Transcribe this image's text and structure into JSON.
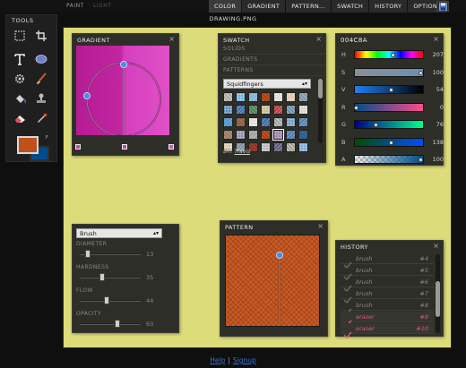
{
  "topbar": {
    "modes": [
      "PAINT",
      "LIGHT"
    ],
    "tabs": [
      "COLOR",
      "GRADIENT",
      "PATTERN...",
      "SWATCH",
      "HISTORY",
      "OPTIONS"
    ]
  },
  "document": {
    "title": "DRAWING.PNG"
  },
  "toolbox": {
    "title": "TOOLS",
    "fg_color": "#c0511b",
    "bg_color": "#004c8a",
    "swap_label": "F"
  },
  "canvas": {
    "background": "#dcdc7a"
  },
  "gradient_panel": {
    "title": "GRADIENT",
    "close": "×",
    "stops": [
      "#b51c94",
      "#e050c8"
    ]
  },
  "swatch_panel": {
    "title": "SWATCH",
    "close": "×",
    "categories": [
      "SOLIDS",
      "GRADIENTS",
      "PATTERNS"
    ],
    "selected_set": "Squidfingers",
    "by_label": "BY:",
    "author": "Travis"
  },
  "color_panel": {
    "title": "004C8A",
    "close": "×",
    "channels": [
      {
        "label": "H",
        "value": "207",
        "fraction": 0.57
      },
      {
        "label": "S",
        "value": "100",
        "fraction": 1.0
      },
      {
        "label": "V",
        "value": "54",
        "fraction": 0.54
      },
      {
        "label": "R",
        "value": "0",
        "fraction": 0.0
      },
      {
        "label": "G",
        "value": "76",
        "fraction": 0.3
      },
      {
        "label": "B",
        "value": "138",
        "fraction": 0.54
      },
      {
        "label": "A",
        "value": "100",
        "fraction": 1.0
      }
    ]
  },
  "brush_panel": {
    "selected_brush": "Brush",
    "sliders": [
      {
        "label": "DIAMETER",
        "value": "13",
        "fraction": 0.1
      },
      {
        "label": "HARDNESS",
        "value": "35",
        "fraction": 0.35
      },
      {
        "label": "FLOW",
        "value": "44",
        "fraction": 0.44
      },
      {
        "label": "OPACITY",
        "value": "63",
        "fraction": 0.63
      }
    ]
  },
  "pattern_panel": {
    "title": "PATTERN",
    "close": "×",
    "fill": "#c0511b"
  },
  "history_panel": {
    "title": "HISTORY",
    "close": "×",
    "items": [
      {
        "name": "brush",
        "id": "#4",
        "active": false
      },
      {
        "name": "brush",
        "id": "#5",
        "active": false
      },
      {
        "name": "brush",
        "id": "#6",
        "active": false
      },
      {
        "name": "brush",
        "id": "#7",
        "active": false
      },
      {
        "name": "brush",
        "id": "#8",
        "active": false
      },
      {
        "name": "eraser",
        "id": "#9",
        "active": true
      },
      {
        "name": "eraser",
        "id": "#10",
        "active": true
      }
    ]
  },
  "footer": {
    "links": [
      "Help",
      "Signup"
    ],
    "separator": "|"
  }
}
